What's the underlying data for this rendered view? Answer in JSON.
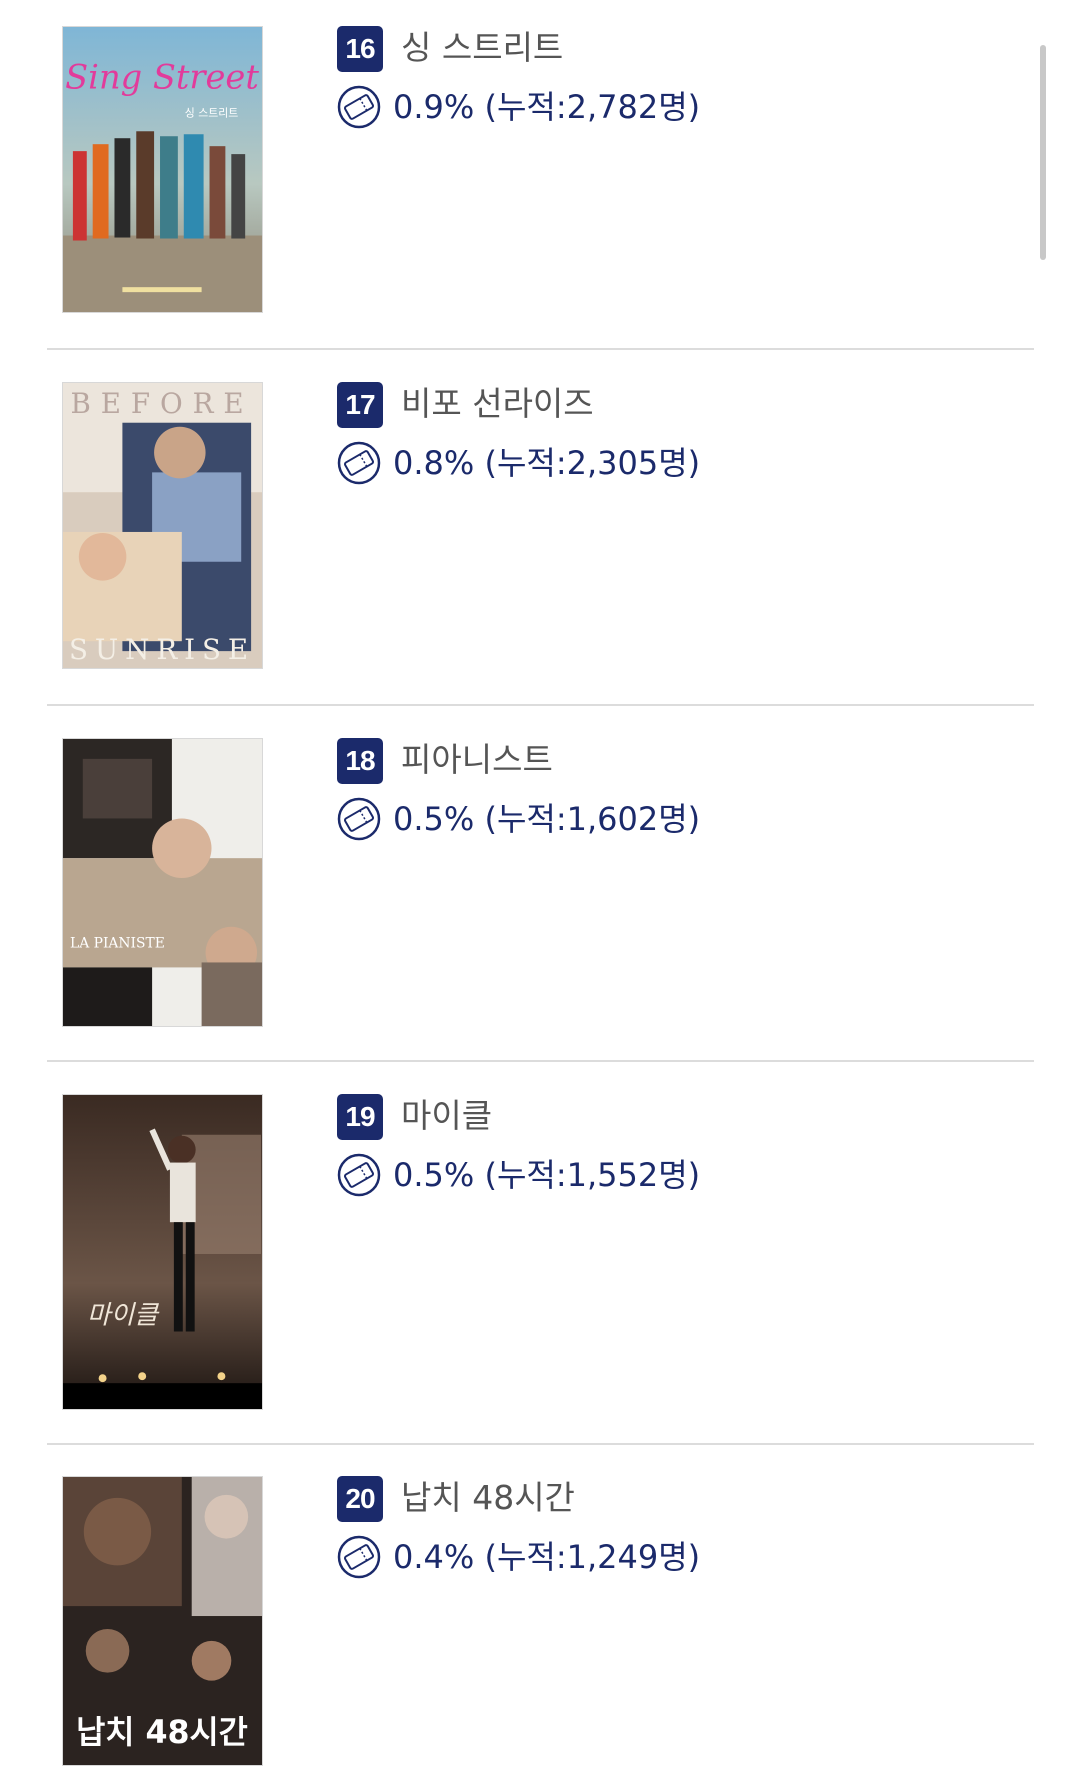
{
  "movies": [
    {
      "rank": "16",
      "title": "싱 스트리트",
      "stat": "0.9% (누적:2,782명)",
      "poster_icon": "sing-street-poster",
      "poster_text": {
        "logo": "Sing Street",
        "sub": "싱 스트리트"
      }
    },
    {
      "rank": "17",
      "title": "비포 선라이즈",
      "stat": "0.8% (누적:2,305명)",
      "poster_icon": "before-sunrise-poster",
      "poster_text": {
        "top": "BEFORE",
        "bottom": "SUNRISE"
      }
    },
    {
      "rank": "18",
      "title": "피아니스트",
      "stat": "0.5% (누적:1,602명)",
      "poster_icon": "the-piano-teacher-poster",
      "poster_text": {
        "logo": "LA PIANISTE"
      }
    },
    {
      "rank": "19",
      "title": "마이클",
      "stat": "0.5% (누적:1,552명)",
      "poster_icon": "michael-poster",
      "poster_text": {
        "logo": "마이클"
      }
    },
    {
      "rank": "20",
      "title": "납치 48시간",
      "stat": "0.4% (누적:1,249명)",
      "poster_icon": "kidnap-48-hours-poster",
      "poster_text": {
        "logo": "납치 48시간"
      }
    }
  ],
  "icons": {
    "ticket": "ticket-icon"
  },
  "colors": {
    "accent": "#1b2a6b",
    "title": "#555555",
    "divider": "#dcdcdc"
  }
}
